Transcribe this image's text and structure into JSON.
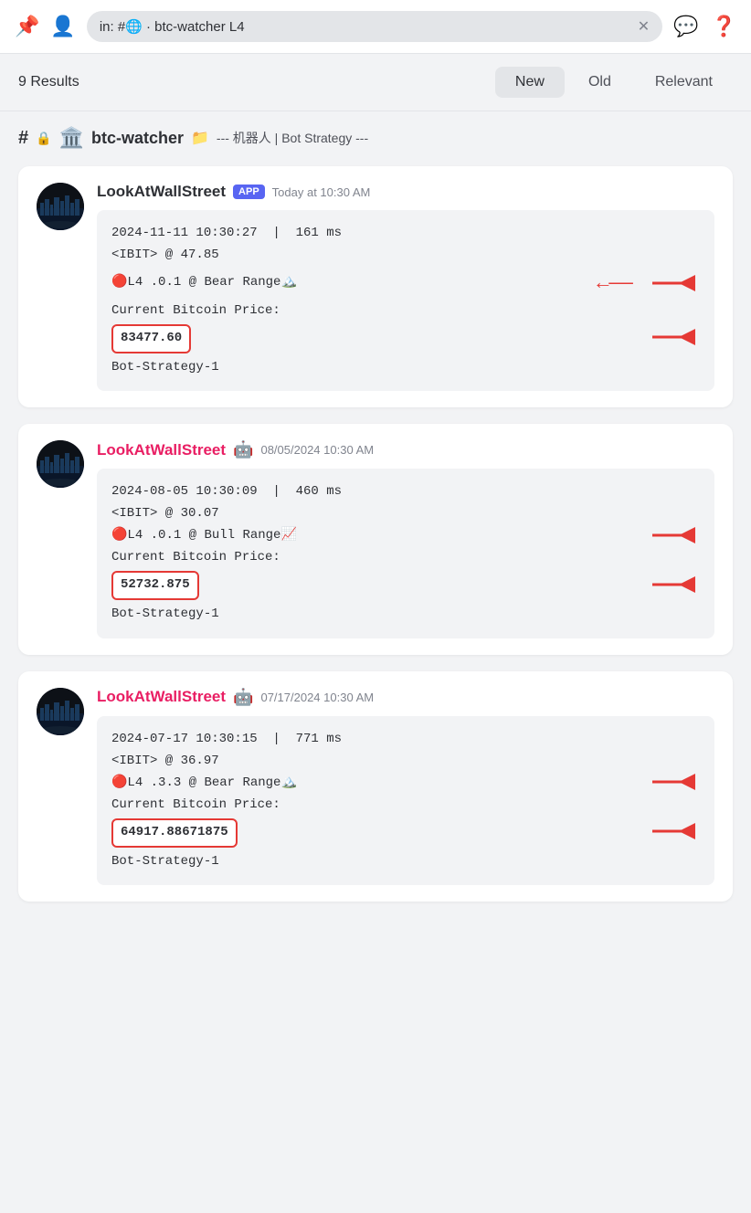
{
  "topbar": {
    "pin_icon": "📌",
    "user_icon": "👤",
    "search_query": "in: #🌐 · btc-watcher  L4",
    "close_icon": "✕",
    "chat_icon": "💬",
    "help_icon": "❓"
  },
  "filter_bar": {
    "results_count": "9 Results",
    "tabs": [
      {
        "label": "New",
        "active": true
      },
      {
        "label": "Old",
        "active": false
      },
      {
        "label": "Relevant",
        "active": false
      }
    ]
  },
  "channel": {
    "hash": "#",
    "lock": "🔒",
    "emoji": "🏛️",
    "name": "btc-watcher",
    "folder_icon": "📁",
    "description": "--- 机器人 | Bot Strategy ---"
  },
  "messages": [
    {
      "username": "LookAtWallStreet",
      "username_color": "dark",
      "badge_type": "app",
      "badge_label": "APP",
      "timestamp": "Today at 10:30 AM",
      "content": {
        "line1": "2024-11-11 10:30:27  |  161 ms",
        "line2": "<IBIT> @ 47.85",
        "line3_prefix": "🔴L4 .0.1 @ Bear Range",
        "line3_suffix": "🏔️",
        "line3_has_arrow": true,
        "line4": "Current Bitcoin Price:",
        "price": "83477.60",
        "price_has_arrow": true,
        "footer": "Bot-Strategy-1"
      }
    },
    {
      "username": "LookAtWallStreet",
      "username_color": "pink",
      "badge_type": "bot",
      "badge_label": "🤖",
      "timestamp": "08/05/2024 10:30 AM",
      "content": {
        "line1": "2024-08-05 10:30:09  |  460 ms",
        "line2": "<IBIT> @ 30.07",
        "line3_prefix": "🔴L4 .0.1 @ Bull Range",
        "line3_suffix": "📈",
        "line3_has_arrow": true,
        "line4": "Current Bitcoin Price:",
        "price": "52732.875",
        "price_has_arrow": true,
        "footer": "Bot-Strategy-1"
      }
    },
    {
      "username": "LookAtWallStreet",
      "username_color": "pink",
      "badge_type": "bot",
      "badge_label": "🤖",
      "timestamp": "07/17/2024 10:30 AM",
      "content": {
        "line1": "2024-07-17 10:30:15  |  771 ms",
        "line2": "<IBIT> @ 36.97",
        "line3_prefix": "🔴L4 .3.3 @ Bear Range",
        "line3_suffix": "🏔️",
        "line3_has_arrow": true,
        "line4": "Current Bitcoin Price:",
        "price": "64917.88671875",
        "price_has_arrow": true,
        "footer": "Bot-Strategy-1"
      }
    }
  ]
}
